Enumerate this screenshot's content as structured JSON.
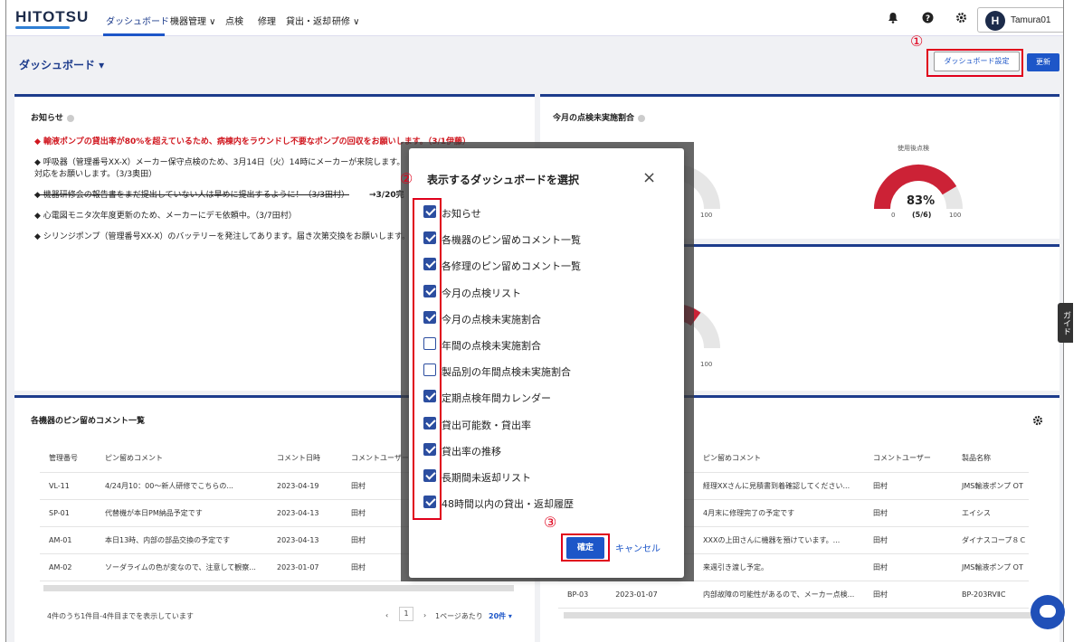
{
  "app": {
    "logo": "HITOTSU"
  },
  "nav": {
    "items": [
      "ダッシュボード",
      "機器管理 ∨",
      "点検",
      "修理",
      "貸出・返却",
      "研修 ∨"
    ],
    "user": {
      "initial": "H",
      "name": "Tamura01"
    }
  },
  "header": {
    "title": "ダッシュボード ▾",
    "settings_label": "ダッシュボード設定",
    "refresh_label": "更新"
  },
  "annotations": {
    "one": "①",
    "two": "②",
    "three": "③"
  },
  "notice_card": {
    "title": "お知らせ",
    "items": [
      {
        "text": "◆ 輸液ポンプの貸出率が80%を超えているため、病棟内をラウンドし不要なポンプの回収をお願いします。（3/1伊藤）",
        "style": "red"
      },
      {
        "text": "◆ 呼吸器（管理番号XX-X）メーカー保守点検のため、3月14日（火）14時にメーカーが来院します。",
        "style": "normal"
      },
      {
        "text": "対応をお願いします。（3/3奥田）",
        "style": "normal"
      },
      {
        "text": "◆ 機器研修会の報告書をまだ提出していない人は早めに提出するように！（3/3田村）",
        "style": "strike"
      },
      {
        "text": "→3/20完",
        "style": "bold"
      },
      {
        "text": "◆ 心電図モニタ次年度更新のため、メーカーにデモ依頼中。（3/7田村）",
        "style": "normal"
      },
      {
        "text": "◆ シリンジポンプ（管理番号XX-X）のバッテリーを発注してあります。届き次第交換をお願いします。",
        "style": "normal"
      }
    ]
  },
  "inspection_card": {
    "title": "今月の点検未実施割合",
    "gauge_caption": "使用後点検",
    "gauge_value": "83%",
    "gauge_sub": "(5/6)",
    "gauge_fraction": 0.83,
    "min": "0",
    "max": "100"
  },
  "pin_card": {
    "title": "各機器のピン留めコメント一覧",
    "columns": [
      "管理番号",
      "ピン留めコメント",
      "コメント日時",
      "コメントユーザー"
    ],
    "rows": [
      [
        "VL-11",
        "4/24月10：00〜新人研修でこちらの...",
        "2023-04-19",
        "田村"
      ],
      [
        "SP-01",
        "代替機が本日PM納品予定です",
        "2023-04-13",
        "田村"
      ],
      [
        "AM-01",
        "本日13時、内部の部品交換の予定です",
        "2023-04-13",
        "田村"
      ],
      [
        "AM-02",
        "ソーダライムの色が変なので、注意して観察...",
        "2023-01-07",
        "田村"
      ]
    ],
    "footer": "4件のうち1件目-4件目までを表示しています",
    "page": "1",
    "per_page_label": "1ページあたり",
    "per_page_value": "20件 ▾"
  },
  "repair_card": {
    "columns": [
      "ピン留めコメント",
      "コメントユーザー",
      "製品名称"
    ],
    "rows": [
      [
        "",
        "経理XXさんに見積書到着確認してください...",
        "田村",
        "JMS輸液ポンプ OT"
      ],
      [
        "",
        "4月末に修理完了の予定です",
        "田村",
        "エイシス"
      ],
      [
        "",
        "XXXの上田さんに機器を預けています。...",
        "田村",
        "ダイナスコープ８Ｃ"
      ],
      [
        "",
        "来週引き渡し予定。",
        "田村",
        "JMS輸液ポンプ OT"
      ],
      [
        "BP-03",
        "内部故障の可能性があるので、メーカー点検...",
        "田村",
        "BP-203RVⅡC"
      ]
    ],
    "row5_date": "2023-01-07"
  },
  "modal": {
    "title": "表示するダッシュボードを選択",
    "close": "×",
    "options": [
      {
        "label": "お知らせ",
        "checked": true
      },
      {
        "label": "各機器のピン留めコメント一覧",
        "checked": true
      },
      {
        "label": "各修理のピン留めコメント一覧",
        "checked": true
      },
      {
        "label": "今月の点検リスト",
        "checked": true
      },
      {
        "label": "今月の点検未実施割合",
        "checked": true
      },
      {
        "label": "年間の点検未実施割合",
        "checked": false
      },
      {
        "label": "製品別の年間点検未実施割合",
        "checked": false
      },
      {
        "label": "定期点検年間カレンダー",
        "checked": true
      },
      {
        "label": "貸出可能数・貸出率",
        "checked": true
      },
      {
        "label": "貸出率の推移",
        "checked": true
      },
      {
        "label": "長期間未返却リスト",
        "checked": true
      },
      {
        "label": "48時間以内の貸出・返却履歴",
        "checked": true
      }
    ],
    "ok_label": "確定",
    "cancel_label": "キャンセル"
  },
  "guide_label": "ガイド",
  "colors": {
    "primary": "#1d56c8",
    "navy": "#1c2b4a",
    "alert": "#d0161e",
    "annotation": "#e0001b"
  }
}
